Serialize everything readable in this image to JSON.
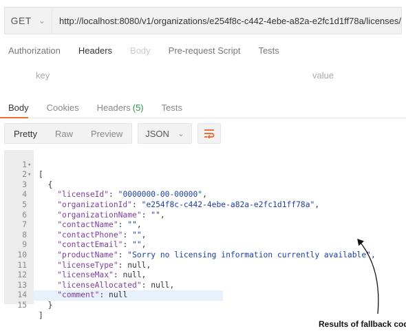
{
  "request": {
    "method": "GET",
    "url": "http://localhost:8080/v1/organizations/e254f8c-c442-4ebe-a82a-e2fc1d1ff78a/licenses/"
  },
  "request_tabs": [
    "Authorization",
    "Headers",
    "Body",
    "Pre-request Script",
    "Tests"
  ],
  "params": {
    "key_placeholder": "key",
    "value_placeholder": "value"
  },
  "response_tabs": {
    "body": "Body",
    "cookies": "Cookies",
    "headers": "Headers",
    "headers_count": "(5)",
    "tests": "Tests"
  },
  "view_modes": [
    "Pretty",
    "Raw",
    "Preview"
  ],
  "format": "JSON",
  "code_lines": [
    {
      "n": "1",
      "fold": true
    },
    {
      "n": "2",
      "fold": true
    },
    {
      "n": "3"
    },
    {
      "n": "4"
    },
    {
      "n": "5"
    },
    {
      "n": "6"
    },
    {
      "n": "7"
    },
    {
      "n": "8"
    },
    {
      "n": "9"
    },
    {
      "n": "10"
    },
    {
      "n": "11"
    },
    {
      "n": "12"
    },
    {
      "n": "13"
    },
    {
      "n": "14"
    },
    {
      "n": "15"
    }
  ],
  "json": {
    "licenseId": "0000000-00-00000",
    "organizationId": "e254f8c-c442-4ebe-a82a-e2fc1d1ff78a",
    "organizationName": "",
    "contactName": "",
    "contactPhone": "",
    "contactEmail": "",
    "productName": "Sorry no licensing information currently available",
    "licenseType": "null",
    "licenseMax": "null",
    "licenseAllocated": "null",
    "comment": "null"
  },
  "annotation": "Results of fallback code",
  "colors": {
    "accent": "#f26b3a",
    "count": "#2f8f4e",
    "key": "#7a3e9d",
    "string": "#1a3fa6"
  }
}
